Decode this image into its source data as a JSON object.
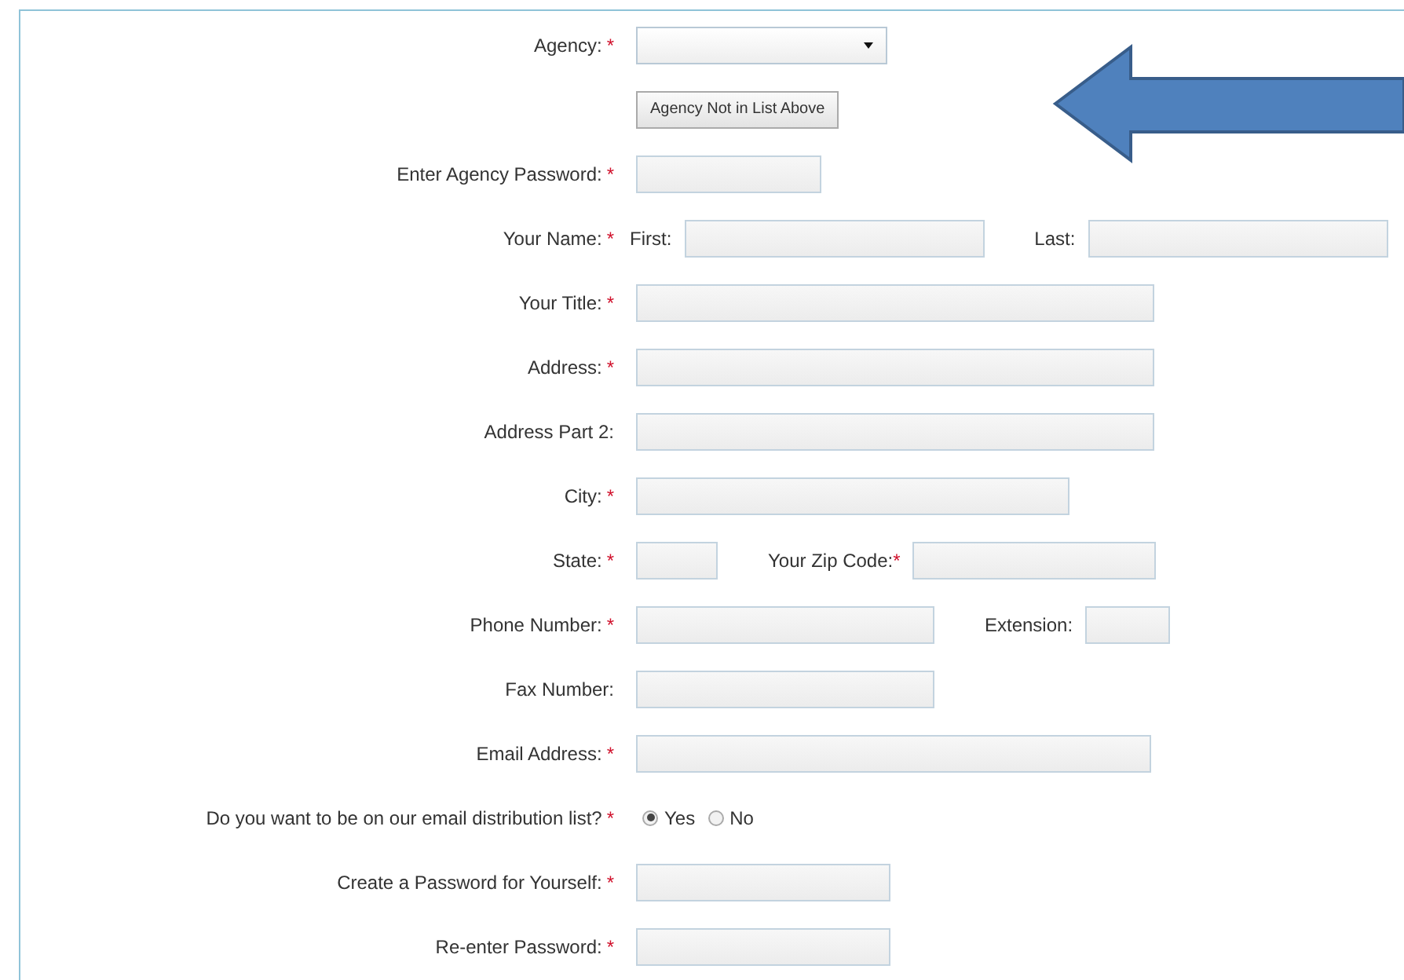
{
  "rows": [
    {
      "label": "Agency:",
      "required": true,
      "items": [
        {
          "kind": "select"
        }
      ]
    },
    {
      "items": [
        {
          "kind": "button",
          "label": "Agency Not in List Above"
        }
      ]
    },
    {
      "label": "Enter Agency Password:",
      "required": true,
      "items": [
        {
          "kind": "input"
        }
      ]
    },
    {
      "label": "Your Name:",
      "required": true,
      "items": [
        {
          "kind": "text",
          "text": "First:"
        },
        {
          "kind": "input"
        },
        {
          "kind": "text",
          "text": "Last:"
        },
        {
          "kind": "input"
        }
      ]
    },
    {
      "label": "Your Title:",
      "required": true,
      "items": [
        {
          "kind": "input"
        }
      ]
    },
    {
      "label": "Address:",
      "required": true,
      "items": [
        {
          "kind": "input"
        }
      ]
    },
    {
      "label": "Address Part 2:",
      "required": false,
      "items": [
        {
          "kind": "input"
        }
      ]
    },
    {
      "label": "City:",
      "required": true,
      "items": [
        {
          "kind": "input"
        }
      ]
    },
    {
      "label": "State:",
      "required": true,
      "items": [
        {
          "kind": "input"
        },
        {
          "kind": "text",
          "text": "Your Zip Code:",
          "required": true
        },
        {
          "kind": "input"
        }
      ]
    },
    {
      "label": "Phone Number:",
      "required": true,
      "items": [
        {
          "kind": "input"
        },
        {
          "kind": "text",
          "text": "Extension:"
        },
        {
          "kind": "input"
        }
      ]
    },
    {
      "label": "Fax Number:",
      "required": false,
      "items": [
        {
          "kind": "input"
        }
      ]
    },
    {
      "label": "Email Address:",
      "required": true,
      "items": [
        {
          "kind": "input"
        }
      ]
    },
    {
      "label": "Do you want to be on our email distribution list?",
      "required": true,
      "items": [
        {
          "kind": "radio",
          "label": "Yes",
          "selected": true
        },
        {
          "kind": "radio",
          "label": "No",
          "selected": false
        }
      ]
    },
    {
      "label": "Create a Password for Yourself:",
      "required": true,
      "items": [
        {
          "kind": "input"
        }
      ]
    },
    {
      "label": "Re-enter Password:",
      "required": true,
      "items": [
        {
          "kind": "input"
        }
      ]
    }
  ],
  "required_mark": "*"
}
